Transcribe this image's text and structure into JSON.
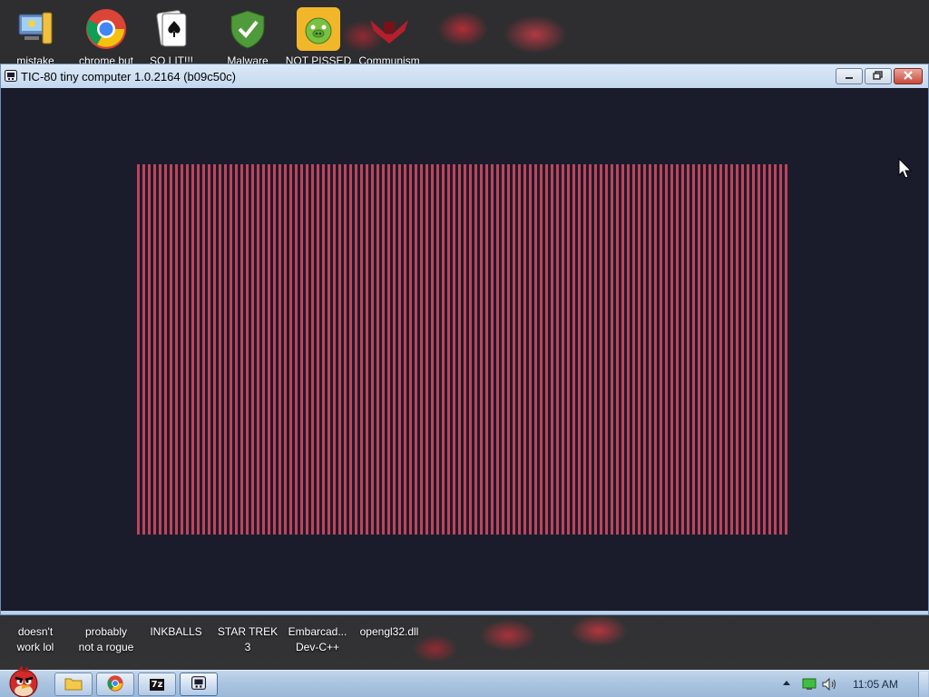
{
  "desktop": {
    "top_icons": [
      {
        "label": "mistake",
        "icon": "computer-icon"
      },
      {
        "label": "chrome but",
        "icon": "chrome-icon"
      },
      {
        "label": "SO LIT!!!",
        "icon": "solitaire-icon"
      },
      {
        "label": "Malware",
        "icon": "shield-check-icon"
      },
      {
        "label": "NOT PISSED",
        "icon": "bad-piggies-icon"
      },
      {
        "label": "Communism",
        "icon": "emblem-icon"
      }
    ],
    "bottom_icons": [
      {
        "label": "doesn't\nwork lol"
      },
      {
        "label": "probably\nnot a rogue"
      },
      {
        "label": "INKBALLS"
      },
      {
        "label": "STAR TREK\n3"
      },
      {
        "label": "Embarcad...\nDev-C++"
      },
      {
        "label": "opengl32.dll"
      }
    ]
  },
  "window": {
    "title": "TIC-80 tiny computer 1.0.2164 (b09c50c)",
    "icon": "tic80-icon",
    "screen": {
      "pattern": "vertical-stripes",
      "stripe_color": "#c2435a",
      "background_color": "#1a1c2c"
    }
  },
  "taskbar": {
    "start_icon": "angry-bird-start-icon",
    "pinned": [
      {
        "name": "explorer",
        "icon": "folder-icon"
      },
      {
        "name": "chrome",
        "icon": "chrome-icon"
      },
      {
        "name": "7zip",
        "icon": "7zip-icon",
        "text": "7z"
      },
      {
        "name": "tic80",
        "icon": "tic80-icon"
      }
    ],
    "tray": {
      "icons": [
        "show-hidden-icon",
        "network-icon",
        "volume-icon"
      ],
      "clock": "11:05 AM"
    }
  },
  "colors": {
    "titlebar": "#c4d8ee",
    "client_bg": "#1a1c2c",
    "stripe": "#c2435a"
  }
}
